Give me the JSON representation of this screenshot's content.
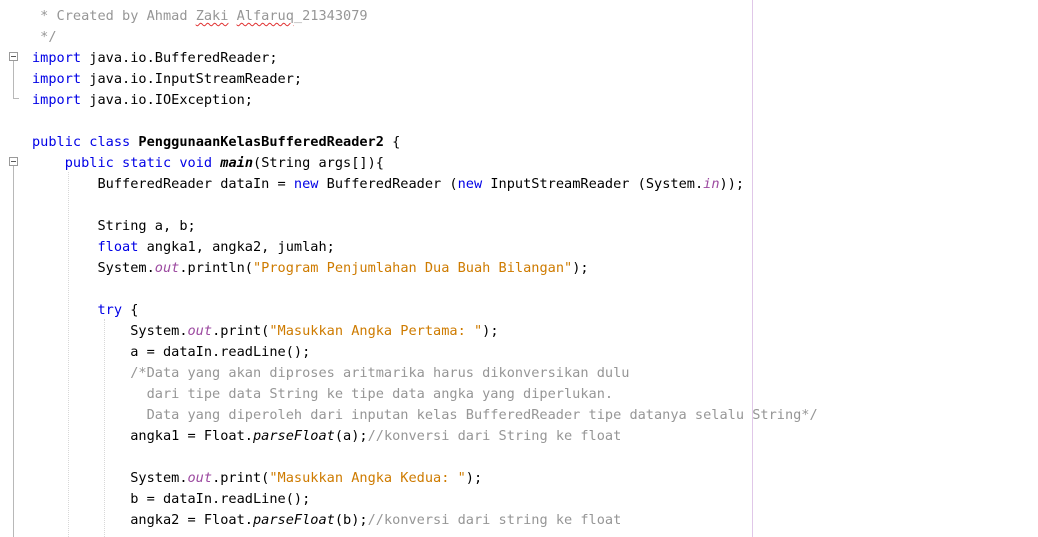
{
  "editor": {
    "lines": [
      [
        {
          "t": " * Created by Ahmad ",
          "c": "cm"
        },
        {
          "t": "Zaki",
          "c": "cm squig"
        },
        {
          "t": " ",
          "c": "cm"
        },
        {
          "t": "Alfaruq",
          "c": "cm squig"
        },
        {
          "t": "_21343079",
          "c": "cm"
        }
      ],
      [
        {
          "t": " */",
          "c": "cm"
        }
      ],
      [
        {
          "t": "import",
          "c": "kw"
        },
        {
          "t": " java.io.BufferedReader;",
          "c": ""
        }
      ],
      [
        {
          "t": "import",
          "c": "kw"
        },
        {
          "t": " java.io.InputStreamReader;",
          "c": ""
        }
      ],
      [
        {
          "t": "import",
          "c": "kw"
        },
        {
          "t": " java.io.IOException;",
          "c": ""
        }
      ],
      [
        {
          "t": "",
          "c": ""
        }
      ],
      [
        {
          "t": "public class",
          "c": "kw"
        },
        {
          "t": " ",
          "c": ""
        },
        {
          "t": "PenggunaanKelasBufferedReader2",
          "c": "cls"
        },
        {
          "t": " {",
          "c": ""
        }
      ],
      [
        {
          "t": "    ",
          "c": ""
        },
        {
          "t": "public static void",
          "c": "kw"
        },
        {
          "t": " ",
          "c": ""
        },
        {
          "t": "main",
          "c": "mthb"
        },
        {
          "t": "(String args[]){",
          "c": ""
        }
      ],
      [
        {
          "t": "        BufferedReader dataIn = ",
          "c": ""
        },
        {
          "t": "new",
          "c": "kw"
        },
        {
          "t": " BufferedReader (",
          "c": ""
        },
        {
          "t": "new",
          "c": "kw"
        },
        {
          "t": " InputStreamReader (System.",
          "c": ""
        },
        {
          "t": "in",
          "c": "fld"
        },
        {
          "t": "));",
          "c": ""
        }
      ],
      [
        {
          "t": "",
          "c": ""
        }
      ],
      [
        {
          "t": "        String a, b;",
          "c": ""
        }
      ],
      [
        {
          "t": "        ",
          "c": ""
        },
        {
          "t": "float",
          "c": "kw"
        },
        {
          "t": " angka1, angka2, jumlah;",
          "c": ""
        }
      ],
      [
        {
          "t": "        System.",
          "c": ""
        },
        {
          "t": "out",
          "c": "fld"
        },
        {
          "t": ".println(",
          "c": ""
        },
        {
          "t": "\"Program Penjumlahan Dua Buah Bilangan\"",
          "c": "st"
        },
        {
          "t": ");",
          "c": ""
        }
      ],
      [
        {
          "t": "",
          "c": ""
        }
      ],
      [
        {
          "t": "        ",
          "c": ""
        },
        {
          "t": "try",
          "c": "kw"
        },
        {
          "t": " {",
          "c": ""
        }
      ],
      [
        {
          "t": "            System.",
          "c": ""
        },
        {
          "t": "out",
          "c": "fld"
        },
        {
          "t": ".print(",
          "c": ""
        },
        {
          "t": "\"Masukkan Angka Pertama: \"",
          "c": "st"
        },
        {
          "t": ");",
          "c": ""
        }
      ],
      [
        {
          "t": "            a = dataIn.readLine();",
          "c": ""
        }
      ],
      [
        {
          "t": "            ",
          "c": ""
        },
        {
          "t": "/*Data yang akan diproses aritmarika harus dikonversikan dulu",
          "c": "cm"
        }
      ],
      [
        {
          "t": "              dari tipe data String ke tipe data angka yang diperlukan.",
          "c": "cm"
        }
      ],
      [
        {
          "t": "              Data yang diperoleh dari inputan kelas BufferedReader tipe datanya selalu String*/",
          "c": "cm"
        }
      ],
      [
        {
          "t": "            angka1 = Float.",
          "c": ""
        },
        {
          "t": "parseFloat",
          "c": "mth"
        },
        {
          "t": "(a);",
          "c": ""
        },
        {
          "t": "//konversi dari String ke float",
          "c": "cm"
        }
      ],
      [
        {
          "t": "",
          "c": ""
        }
      ],
      [
        {
          "t": "            System.",
          "c": ""
        },
        {
          "t": "out",
          "c": "fld"
        },
        {
          "t": ".print(",
          "c": ""
        },
        {
          "t": "\"Masukkan Angka Kedua: \"",
          "c": "st"
        },
        {
          "t": ");",
          "c": ""
        }
      ],
      [
        {
          "t": "            b = dataIn.readLine();",
          "c": ""
        }
      ],
      [
        {
          "t": "            angka2 = Float.",
          "c": ""
        },
        {
          "t": "parseFloat",
          "c": "mth"
        },
        {
          "t": "(b);",
          "c": ""
        },
        {
          "t": "//konversi dari string ke float",
          "c": "cm"
        }
      ]
    ]
  }
}
